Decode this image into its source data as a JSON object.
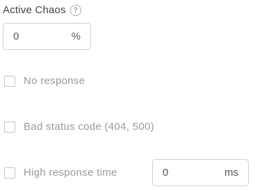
{
  "active_chaos": {
    "title": "Active Chaos",
    "help_icon": "question-circle-icon",
    "input_value": "0",
    "input_unit": "%"
  },
  "options": [
    {
      "label": "No response",
      "checked": false
    },
    {
      "label": "Bad status code (404, 500)",
      "checked": false
    },
    {
      "label": "High response time",
      "checked": false
    }
  ],
  "response_time": {
    "value": "0",
    "unit": "ms"
  },
  "colors": {
    "title_text": "#444444",
    "label_text_disabled": "#9a9a9a",
    "border": "#cfcfcf",
    "checkbox_border": "#c4c4c4"
  }
}
